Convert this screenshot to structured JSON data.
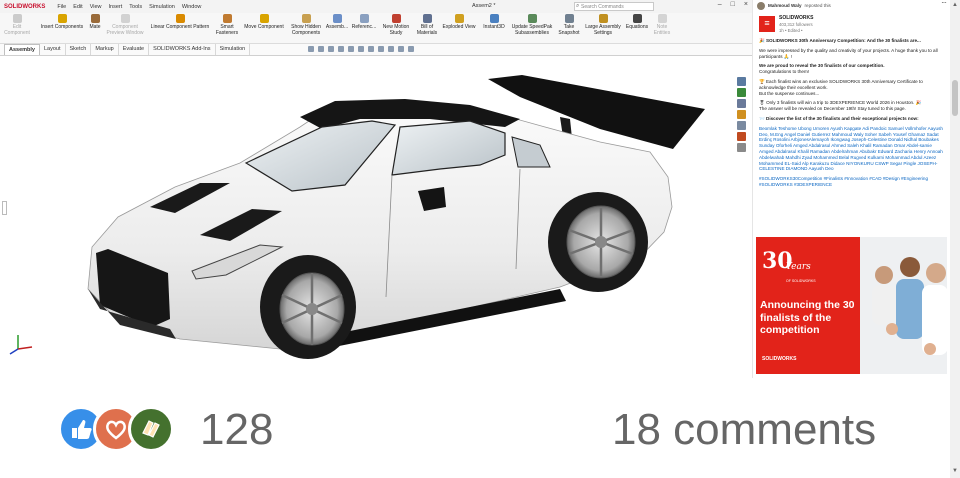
{
  "solidworks": {
    "logo": "SOLIDWORKS",
    "menu": [
      "File",
      "Edit",
      "View",
      "Insert",
      "Tools",
      "Simulation",
      "Window"
    ],
    "document_title": "Assem2 *",
    "search_placeholder": "Search Commands",
    "ribbon": [
      {
        "label": "Edit Component",
        "icon": "edit-component-icon",
        "color": "#8a8a8a",
        "enabled": false
      },
      {
        "label": "Insert Components",
        "icon": "insert-components-icon",
        "color": "#d9a400",
        "enabled": true
      },
      {
        "label": "Mate",
        "icon": "mate-icon",
        "color": "#9a6b3a",
        "enabled": true
      },
      {
        "label": "Component Preview Window",
        "icon": "preview-window-icon",
        "color": "#9a9a9a",
        "enabled": false
      },
      {
        "label": "Linear Component Pattern",
        "icon": "linear-pattern-icon",
        "color": "#d98a00",
        "enabled": true
      },
      {
        "label": "Smart Fasteners",
        "icon": "smart-fasteners-icon",
        "color": "#c07a30",
        "enabled": true
      },
      {
        "label": "Move Component",
        "icon": "move-component-icon",
        "color": "#d9a400",
        "enabled": true
      },
      {
        "label": "Show Hidden Components",
        "icon": "show-hidden-icon",
        "color": "#c8a050",
        "enabled": true
      },
      {
        "label": "Assemb...",
        "icon": "assembly-features-icon",
        "color": "#6b8fc8",
        "enabled": true
      },
      {
        "label": "Referenc...",
        "icon": "reference-geometry-icon",
        "color": "#8aa0c0",
        "enabled": true
      },
      {
        "label": "New Motion Study",
        "icon": "motion-study-icon",
        "color": "#c04030",
        "enabled": true
      },
      {
        "label": "Bill of Materials",
        "icon": "bom-icon",
        "color": "#607090",
        "enabled": true
      },
      {
        "label": "Exploded View",
        "icon": "exploded-view-icon",
        "color": "#d0a020",
        "enabled": true
      },
      {
        "label": "Instant3D",
        "icon": "instant3d-icon",
        "color": "#4a80c0",
        "enabled": true
      },
      {
        "label": "Update SpeedPak Subassemblies",
        "icon": "speedpak-icon",
        "color": "#5a8a5a",
        "enabled": true
      },
      {
        "label": "Take Snapshot",
        "icon": "snapshot-icon",
        "color": "#708090",
        "enabled": true
      },
      {
        "label": "Large Assembly Settings",
        "icon": "large-assembly-icon",
        "color": "#c09020",
        "enabled": true
      },
      {
        "label": "Equations",
        "icon": "equations-icon",
        "color": "#444444",
        "enabled": true
      },
      {
        "label": "Note Entities",
        "icon": "note-entities-icon",
        "color": "#a0a0a0",
        "enabled": false
      }
    ],
    "tabs": [
      {
        "label": "Assembly",
        "active": true
      },
      {
        "label": "Layout",
        "active": false
      },
      {
        "label": "Sketch",
        "active": false
      },
      {
        "label": "Markup",
        "active": false
      },
      {
        "label": "Evaluate",
        "active": false
      },
      {
        "label": "SOLIDWORKS Add-Ins",
        "active": false
      },
      {
        "label": "Simulation",
        "active": false
      }
    ],
    "colors": {
      "accent": "#c8102e",
      "car_body": "#f2f2f2",
      "car_roof": "#141414"
    }
  },
  "linkedin": {
    "repost_name": "Mahmoud Waly",
    "repost_action": "reposted this",
    "author": "SOLIDWORKS",
    "followers": "403,312 followers",
    "time": "1h • Edited •",
    "headline": "🎉 SOLIDWORKS 30th Anniversary Competition: And the 30 finalists are...",
    "p1": "We were impressed by the quality and creativity of your projects. A huge thank you to all participants 🙏 !",
    "p2a": "We are proud to reveal the 30 finalists of our competition.",
    "p2b": "Congratulations to them!",
    "p3a": "🏆 Each finalist wins an exclusive SOLIDWORKS 30th Anniversary Certificate to acknowledge their excellent work.",
    "p3b": "But the suspense continues...",
    "p4a": "🎖 Only 3 finalists will win a trip to 3DEXPERIENCE World 2026 in Houston. 🎉",
    "p4b": "The answer will be revealed on December 19th! Stay tuned to this page.",
    "p5": "📨 Discover the list of the 30 finalists and their exceptional projects now:",
    "names": "Beomlak Teshome Ubong Umoren Ayush Kapgate Adi Pandoic Samuel Vollmhofer Aayush Deo, M.Eng Angel Daniel Gutierrez Mahmoud Waly Soher Sabeh Yousef Ghamaz Sadat Erdinç Rosolini ArbjonesAlemayoh Ikongwag Joseph-Celestine Donald Nidhal Boubakes Sunday Oforheli Amged Abdalrasul Ahmed Saleh Khalil Ramadan Omar Abdel-samie Amged Abdalrasul Khalil Ramadan Abdelrahman Abubakr Edward Zacharia Henry Annoah Abdelwahab Mahdhi Zyad Mohammed Belal Rugved Kulkarni Mohammad Abdul Azeez Mohammed EL-Said Alp Karakuzu Didace NIYONKURU CSWP Segar Pingle JOSEPH-CELESTINE DIAMOND Aayush Deo",
    "hashtags": "#SOLIDWORKS30Competition #Finalists #Innovation #CAD #Design #Engineering #SOLIDWORKS #3DEXPERIENCE",
    "banner": {
      "years_number": "30",
      "years_word": "Years",
      "years_sub": "OF SOLIDWORKS",
      "headline": "Announcing the 30 finalists of the competition",
      "footer": "SOLIDWORKS",
      "color": "#e2231a"
    }
  },
  "social": {
    "reaction_count": "128",
    "comments": "18 comments",
    "reactions": [
      {
        "icon": "like-icon",
        "color": "#378fe9"
      },
      {
        "icon": "love-icon",
        "color": "#df704d"
      },
      {
        "icon": "celebrate-icon",
        "color": "#44712e"
      }
    ]
  }
}
